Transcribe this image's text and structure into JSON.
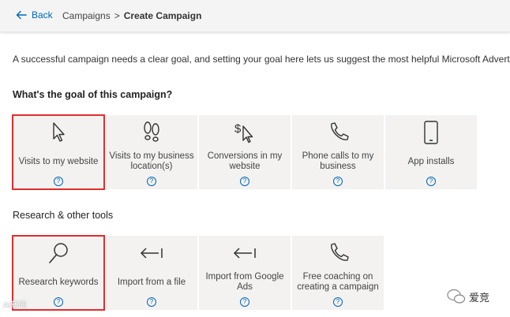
{
  "topbar": {
    "back_label": "Back",
    "breadcrumb_parent": "Campaigns",
    "breadcrumb_separator": ">",
    "breadcrumb_current": "Create Campaign"
  },
  "intro_text": "A successful campaign needs a clear goal, and setting your goal here lets us suggest the most helpful Microsoft Advertising",
  "goal_heading": "What's the goal of this campaign?",
  "goals": [
    {
      "label": "Visits to my website",
      "icon": "cursor-icon",
      "help": "?"
    },
    {
      "label": "Visits to my business location(s)",
      "icon": "footprints-icon",
      "help": "?"
    },
    {
      "label": "Conversions in my website",
      "icon": "dollar-cursor-icon",
      "help": "?"
    },
    {
      "label": "Phone calls to my business",
      "icon": "phone-icon",
      "help": "?"
    },
    {
      "label": "App installs",
      "icon": "mobile-icon",
      "help": "?"
    }
  ],
  "tools_heading": "Research & other tools",
  "tools": [
    {
      "label": "Research keywords",
      "icon": "search-icon",
      "help": "?"
    },
    {
      "label": "Import from a file",
      "icon": "import-arrow-icon",
      "help": "?"
    },
    {
      "label": "Import from Google Ads",
      "icon": "import-arrow-icon",
      "help": "?"
    },
    {
      "label": "Free coaching on creating a campaign",
      "icon": "phone-icon",
      "help": "?"
    }
  ],
  "watermark": {
    "right": "爱竞",
    "left": "AI新闻"
  },
  "colors": {
    "accent": "#0067b8",
    "selection": "#e12d2d",
    "tile_bg": "#f3f2f1"
  }
}
